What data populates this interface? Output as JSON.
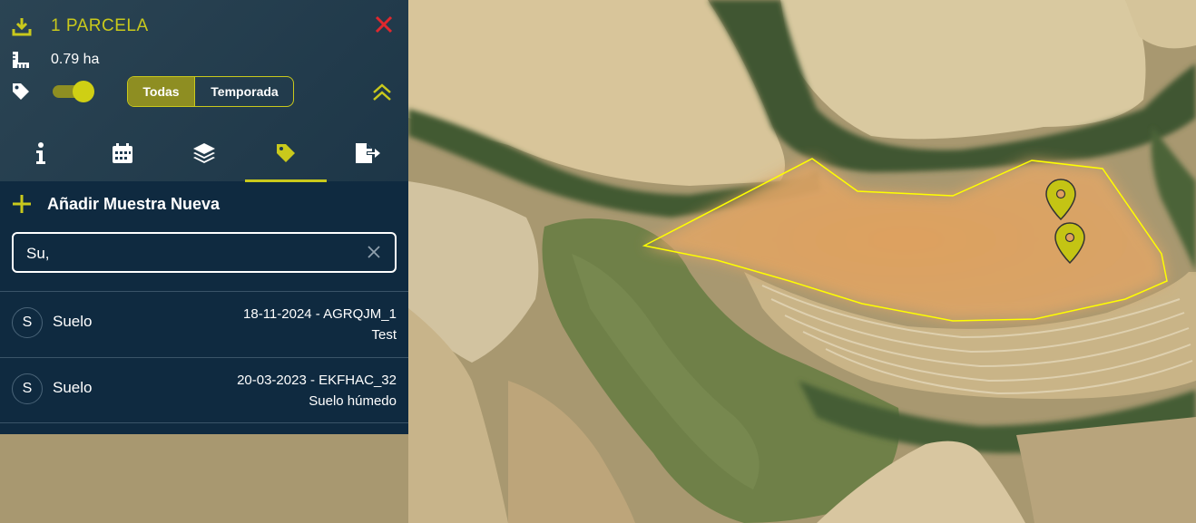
{
  "header": {
    "title": "1 PARCELA",
    "area": "0.79 ha",
    "filter_options": [
      "Todas",
      "Temporada"
    ],
    "selected_filter": "Todas",
    "tag_toggle_on": true
  },
  "tabs": [
    {
      "name": "info",
      "icon": "info-icon"
    },
    {
      "name": "calendar",
      "icon": "calendar-icon"
    },
    {
      "name": "layers",
      "icon": "layers-icon"
    },
    {
      "name": "tags",
      "icon": "tag-icon",
      "active": true
    },
    {
      "name": "export",
      "icon": "export-icon"
    }
  ],
  "samples": {
    "add_label": "Añadir Muestra Nueva",
    "search_value": "Su,",
    "items": [
      {
        "initial": "S",
        "name": "Suelo",
        "code": "18-11-2024 - AGRQJM_1",
        "note": "Test"
      },
      {
        "initial": "S",
        "name": "Suelo",
        "code": "20-03-2023 - EKFHAC_32",
        "note": "Suelo húmedo"
      }
    ]
  },
  "colors": {
    "accent": "#c9c91c",
    "panel": "#0f2a40",
    "close": "#e0282e",
    "parcel_fill": "#e2a060",
    "parcel_border": "#ffff00"
  }
}
